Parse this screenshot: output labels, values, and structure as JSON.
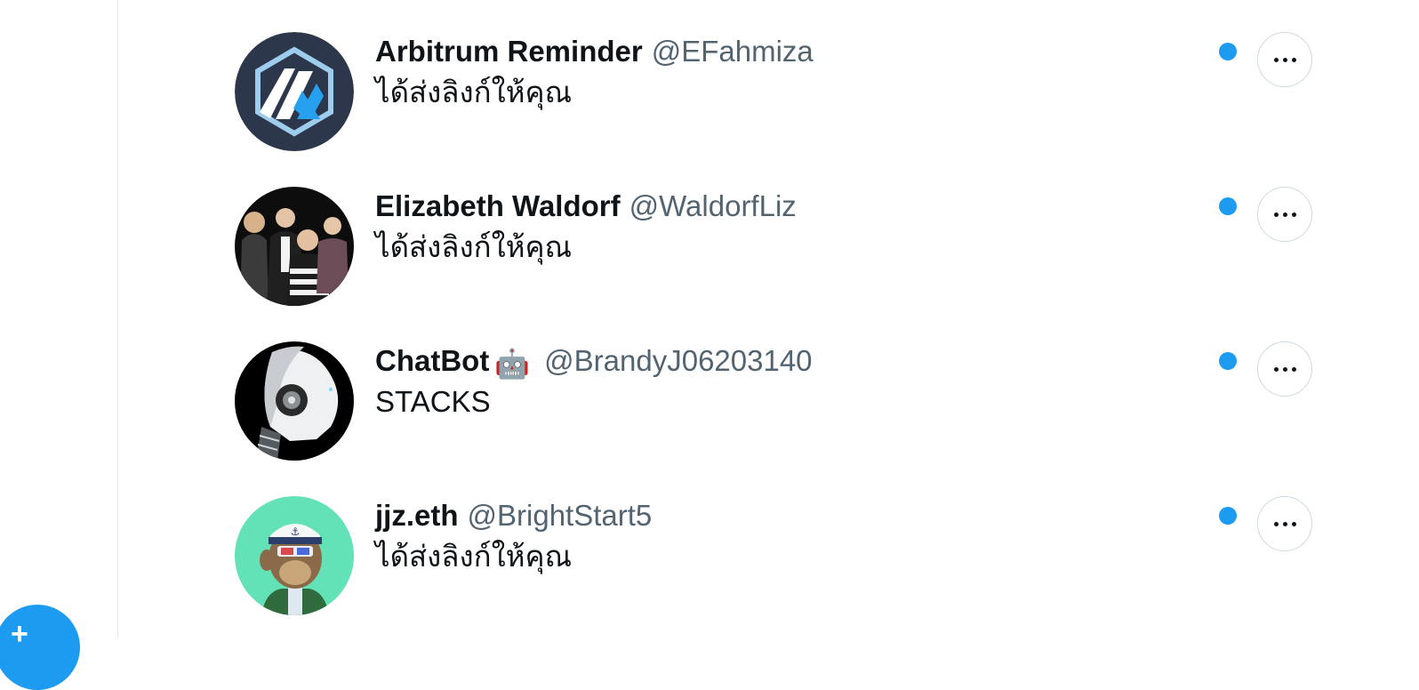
{
  "colors": {
    "accent": "#1d9bf0",
    "text": "#0f1419",
    "secondary": "#536471",
    "divider": "#e6e9ec"
  },
  "icons": {
    "compose": "plus-icon",
    "more": "more-horizontal-icon",
    "unread": "unread-dot-icon"
  },
  "conversations": [
    {
      "name": "Arbitrum Reminder",
      "emoji": "",
      "handle": "@EFahmiza",
      "preview": "ได้ส่งลิงก์ให้คุณ",
      "avatar": "arbitrum-logo-avatar",
      "unread": true
    },
    {
      "name": "Elizabeth Waldorf",
      "emoji": "",
      "handle": "@WaldorfLiz",
      "preview": "ได้ส่งลิงก์ให้คุณ",
      "avatar": "family-photo-avatar",
      "unread": true
    },
    {
      "name": "ChatBot",
      "emoji": "🤖",
      "handle": "@BrandyJ06203140",
      "preview": "STACKS",
      "avatar": "robot-avatar",
      "unread": true
    },
    {
      "name": "jjz.eth",
      "emoji": "",
      "handle": "@BrightStart5",
      "preview": "ได้ส่งลิงก์ให้คุณ",
      "avatar": "ape-nft-avatar",
      "unread": true
    }
  ]
}
